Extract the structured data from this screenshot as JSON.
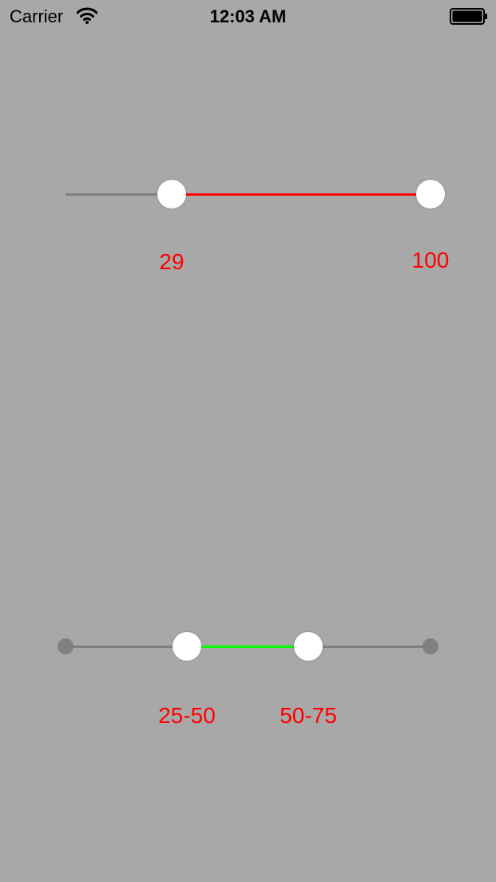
{
  "status_bar": {
    "carrier": "Carrier",
    "time": "12:03 AM",
    "wifi_icon": "wifi-icon",
    "battery_icon": "battery-icon"
  },
  "colors": {
    "background": "#a8a8a8",
    "track_inactive": "#808080",
    "range_slider_fill": "#ff0000",
    "stepped_slider_fill": "#00ff00",
    "value_text": "#ff0000",
    "thumb": "#ffffff"
  },
  "range_slider": {
    "min": 0,
    "max": 100,
    "lower_value": 29,
    "upper_value": 100,
    "lower_label": "29",
    "upper_label": "100"
  },
  "stepped_slider": {
    "steps": [
      0,
      25,
      50,
      75,
      100
    ],
    "lower_value": 25,
    "upper_value": 75,
    "lower_label": "25-50",
    "upper_label": "50-75"
  }
}
